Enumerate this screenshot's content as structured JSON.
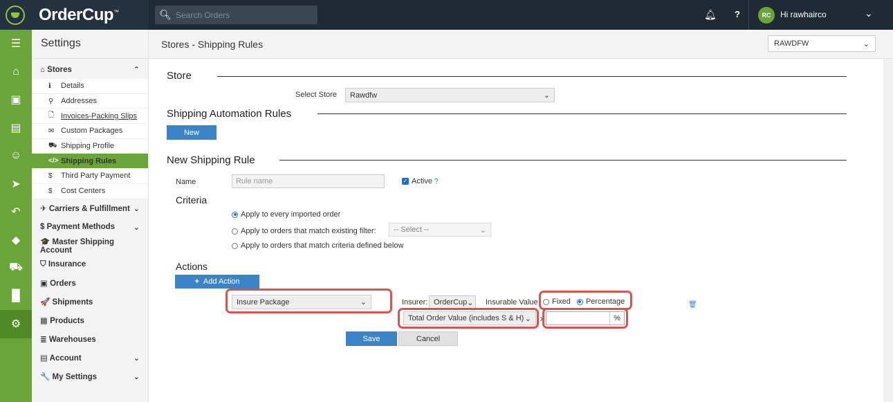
{
  "app": {
    "brand": "OrderCup",
    "brand_mark": "™"
  },
  "topbar": {
    "search_placeholder": "Search Orders",
    "help_label": "?",
    "user_initials": "RC",
    "user_greeting": "Hi rawhairco"
  },
  "sidebar": {
    "title": "Settings",
    "stores_group": "Stores",
    "stores_items": [
      {
        "label": "Details",
        "icon": "ℹ"
      },
      {
        "label": "Addresses",
        "icon": "⚲"
      },
      {
        "label": "Invoices-Packing Slips",
        "icon": "🗋"
      },
      {
        "label": "Custom Packages",
        "icon": "✉"
      },
      {
        "label": "Shipping Profile",
        "icon": "⛟"
      },
      {
        "label": "Shipping Rules",
        "icon": "</>"
      },
      {
        "label": "Third Party Payment",
        "icon": "$"
      },
      {
        "label": "Cost Centers",
        "icon": "$"
      }
    ],
    "groups": [
      {
        "label": "Carriers & Fulfillment",
        "icon": "✈",
        "chevron": true
      },
      {
        "label": "Payment Methods",
        "icon": "$",
        "chevron": true
      },
      {
        "label": "Master Shipping Account",
        "icon": "🎓",
        "chevron": false
      },
      {
        "label": "Insurance",
        "icon": "⛉",
        "chevron": false
      },
      {
        "label": "Orders",
        "icon": "▣",
        "chevron": false
      },
      {
        "label": "Shipments",
        "icon": "🚀",
        "chevron": false
      },
      {
        "label": "Products",
        "icon": "▦",
        "chevron": false
      },
      {
        "label": "Warehouses",
        "icon": "≣",
        "chevron": false
      },
      {
        "label": "Account",
        "icon": "▤",
        "chevron": true
      },
      {
        "label": "My Settings",
        "icon": "🔧",
        "chevron": true
      }
    ]
  },
  "header": {
    "title": "Stores - Shipping Rules",
    "store_value": "RAWDFW"
  },
  "store_section": {
    "title": "Store",
    "select_label": "Select Store",
    "select_value": "Rawdfw"
  },
  "automation": {
    "title": "Shipping Automation Rules",
    "new_label": "New"
  },
  "new_rule": {
    "title": "New Shipping Rule",
    "name_label": "Name",
    "name_placeholder": "Rule name",
    "active_label": "Active",
    "active_help": "?",
    "criteria_title": "Criteria",
    "criteria_options": [
      "Apply to every imported order",
      "Apply to orders that match existing filter:",
      "Apply to orders that match criteria defined below"
    ],
    "filter_placeholder": "-- Select --",
    "actions_title": "Actions",
    "add_action_label": "Add Action",
    "action_select": "Insure Package",
    "insurer_label": "Insurer:",
    "insurer_value": "OrderCup",
    "insurable_label": "Insurable Value",
    "fixed_label": "Fixed",
    "percentage_label": "Percentage",
    "value_basis": "Total Order Value (includes S & H)",
    "times": "x",
    "percent_sign": "%",
    "save_label": "Save",
    "cancel_label": "Cancel"
  }
}
